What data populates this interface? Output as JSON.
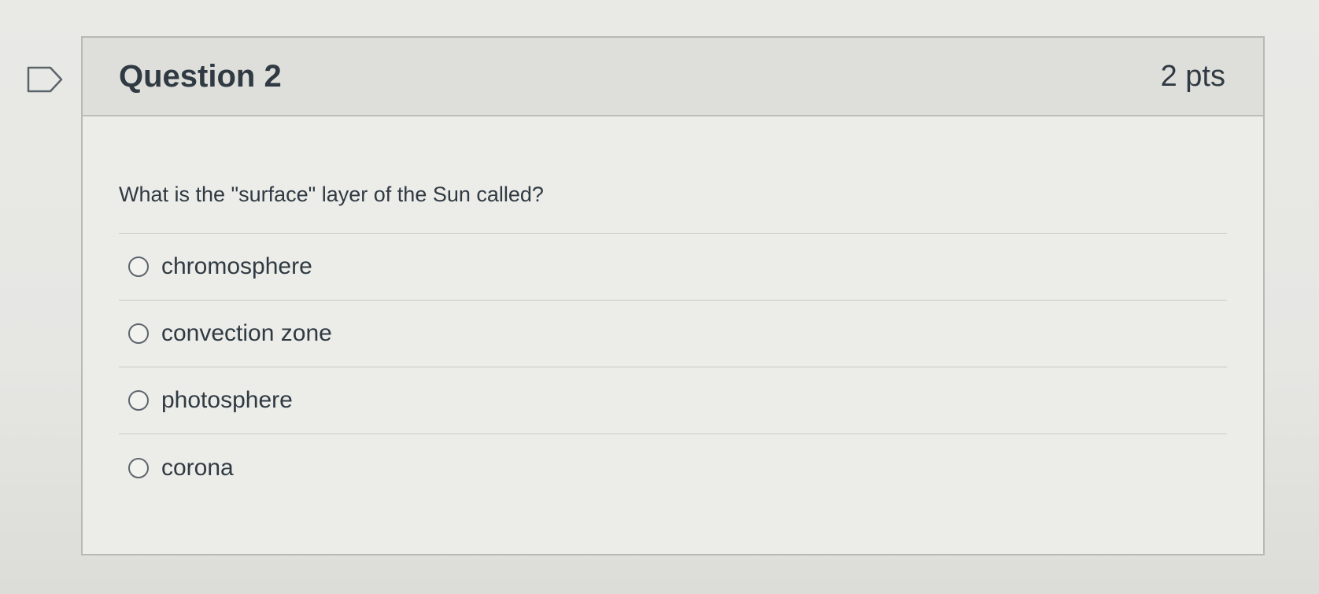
{
  "question": {
    "title": "Question 2",
    "points": "2 pts",
    "text": "What is the \"surface\" layer of the Sun called?",
    "answers": [
      {
        "label": "chromosphere"
      },
      {
        "label": "convection zone"
      },
      {
        "label": "photosphere"
      },
      {
        "label": "corona"
      }
    ]
  },
  "icons": {
    "flag": "flag-question-icon",
    "radio": "radio-unselected-icon"
  }
}
